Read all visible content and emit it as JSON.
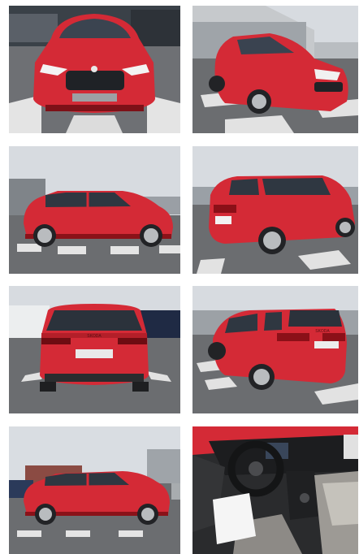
{
  "gallery": {
    "columns": 2,
    "photos": [
      {
        "view": "front",
        "plate": "",
        "badge": ""
      },
      {
        "view": "front-left",
        "plate": "",
        "badge": ""
      },
      {
        "view": "side-left",
        "plate": "",
        "badge": ""
      },
      {
        "view": "rear-left",
        "plate": "",
        "badge": ""
      },
      {
        "view": "rear",
        "plate": "",
        "badge": "SKODA"
      },
      {
        "view": "rear-right",
        "plate": "",
        "badge": "SKODA"
      },
      {
        "view": "side-left-far",
        "plate": "",
        "badge": ""
      },
      {
        "view": "interior",
        "plate": "",
        "badge": ""
      }
    ]
  },
  "colors": {
    "car_red": "#d42a36",
    "car_red_dark": "#9c1820",
    "sky": "#d9dde2",
    "asphalt": "#5d5f62",
    "stripe": "#e6e6e6",
    "interior_dark": "#2a2b2d",
    "interior_light": "#9d9a95"
  }
}
